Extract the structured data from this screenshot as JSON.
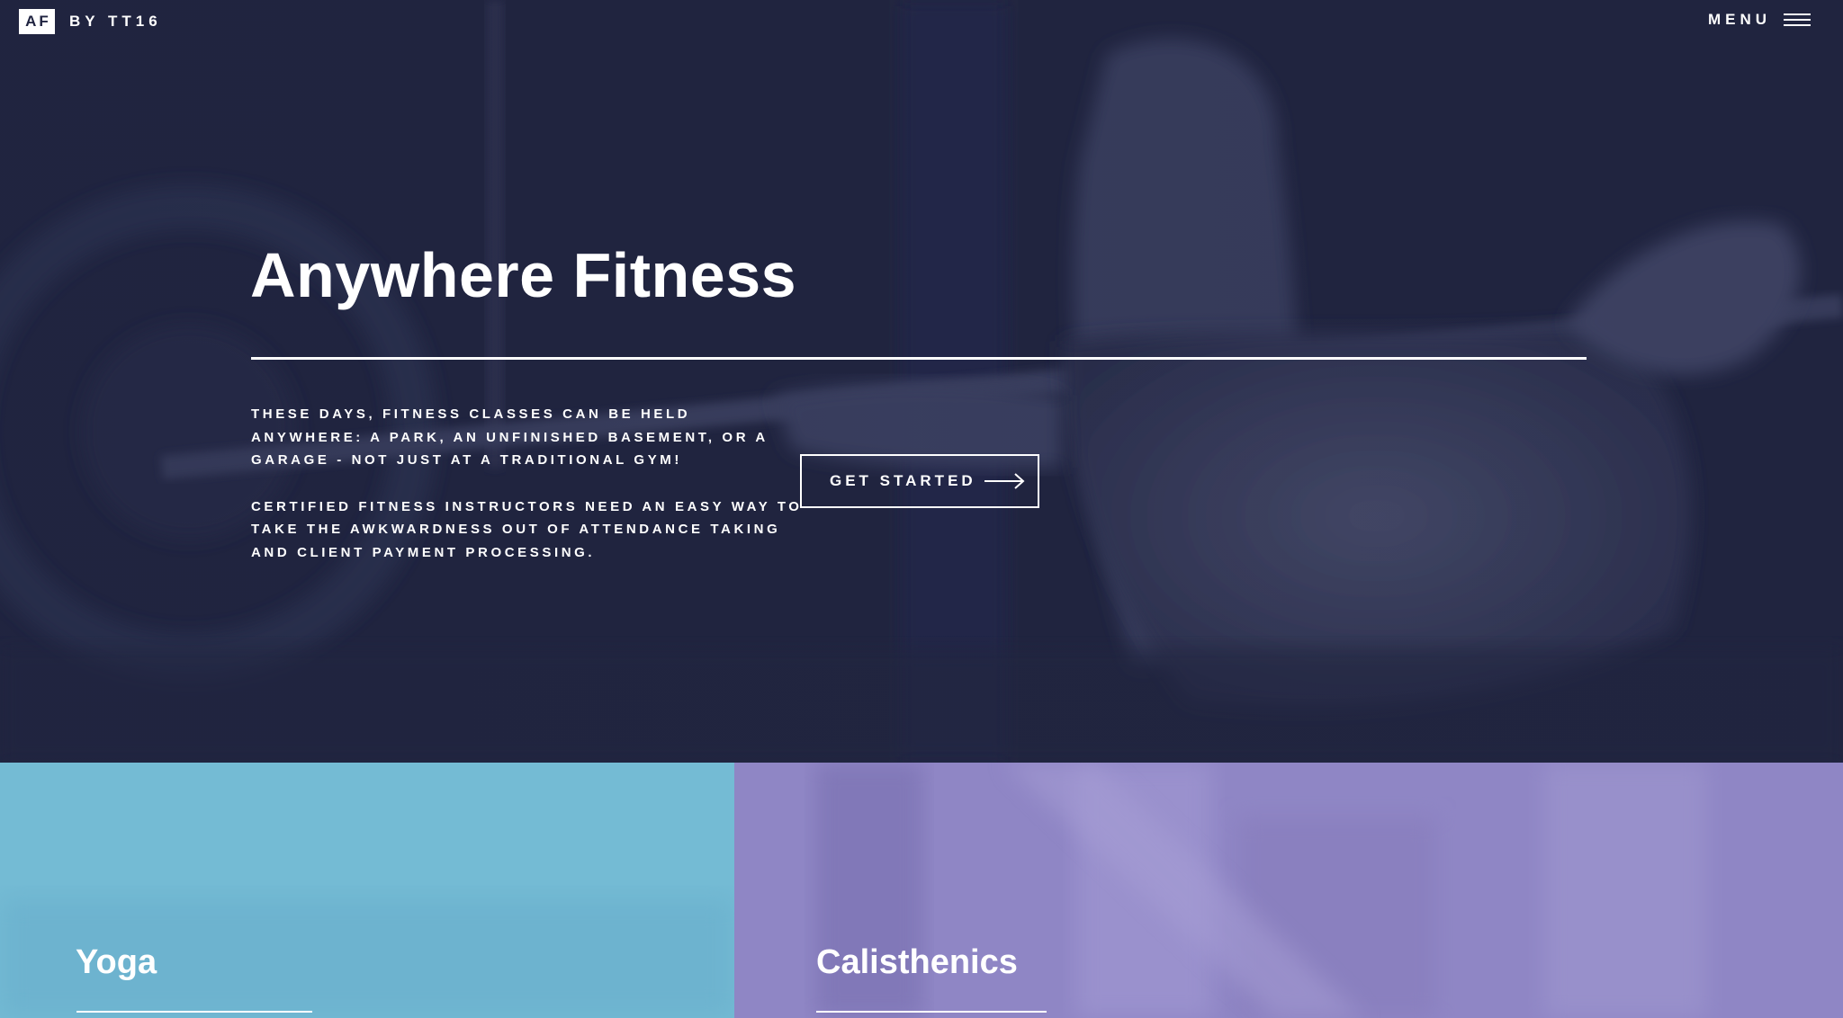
{
  "brand": {
    "badge": "AF",
    "byline": "BY TT16"
  },
  "nav": {
    "menu_label": "MENU"
  },
  "hero": {
    "title": "Anywhere Fitness",
    "paragraph_1": "THESE DAYS, FITNESS CLASSES CAN BE HELD ANYWHERE: A PARK, AN UNFINISHED BASEMENT, OR A GARAGE - NOT JUST AT A TRADITIONAL GYM!",
    "paragraph_2": "CERTIFIED FITNESS INSTRUCTORS NEED AN EASY WAY TO TAKE THE AWKWARDNESS OUT OF ATTENDANCE TAKING AND CLIENT PAYMENT PROCESSING.",
    "cta_label": "GET STARTED"
  },
  "classes": [
    {
      "title": "Yoga",
      "color": "#74bbd4"
    },
    {
      "title": "Calisthenics",
      "color": "#8f86c5"
    }
  ],
  "colors": {
    "hero_bg": "#1f2340",
    "text": "#ffffff"
  }
}
